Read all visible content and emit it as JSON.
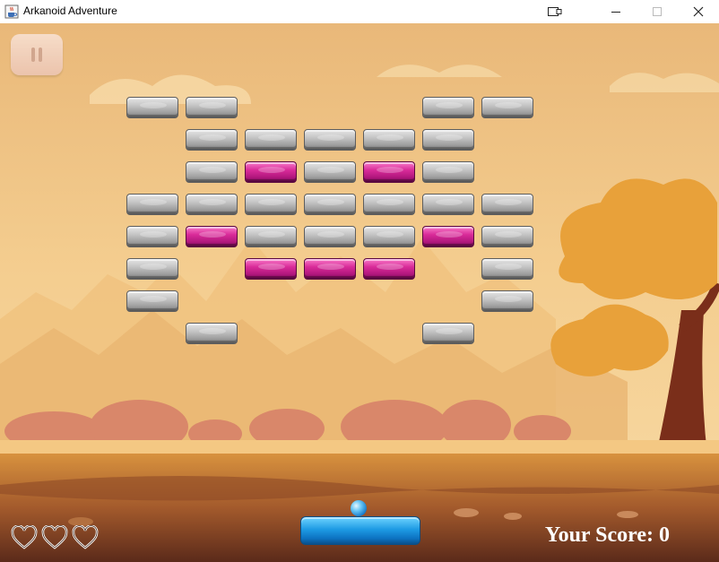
{
  "window": {
    "title": "Arkanoid Adventure",
    "icon": "java-cup-icon",
    "controls": [
      "tablet-mode-icon",
      "minimize-icon",
      "maximize-icon",
      "close-icon"
    ]
  },
  "hud": {
    "score_label": "Your Score:",
    "score_value": "0",
    "lives": 3,
    "pause_icon": "pause-icon"
  },
  "board": {
    "legend": {
      "G": "gray",
      "P": "pink",
      ".": "empty"
    },
    "rows": [
      "GG...GG",
      ".GGGGG.",
      ".GPGPG.",
      "GGGGGGG",
      "GPGGGPG",
      "G.PPP.G",
      "G.....G",
      ".G...G."
    ]
  },
  "colors": {
    "sky": "#f3c786",
    "brick_gray": "#b8b8b8",
    "brick_pink": "#d3288f",
    "paddle": "#1e9be4",
    "score_text": "#ffffff"
  }
}
